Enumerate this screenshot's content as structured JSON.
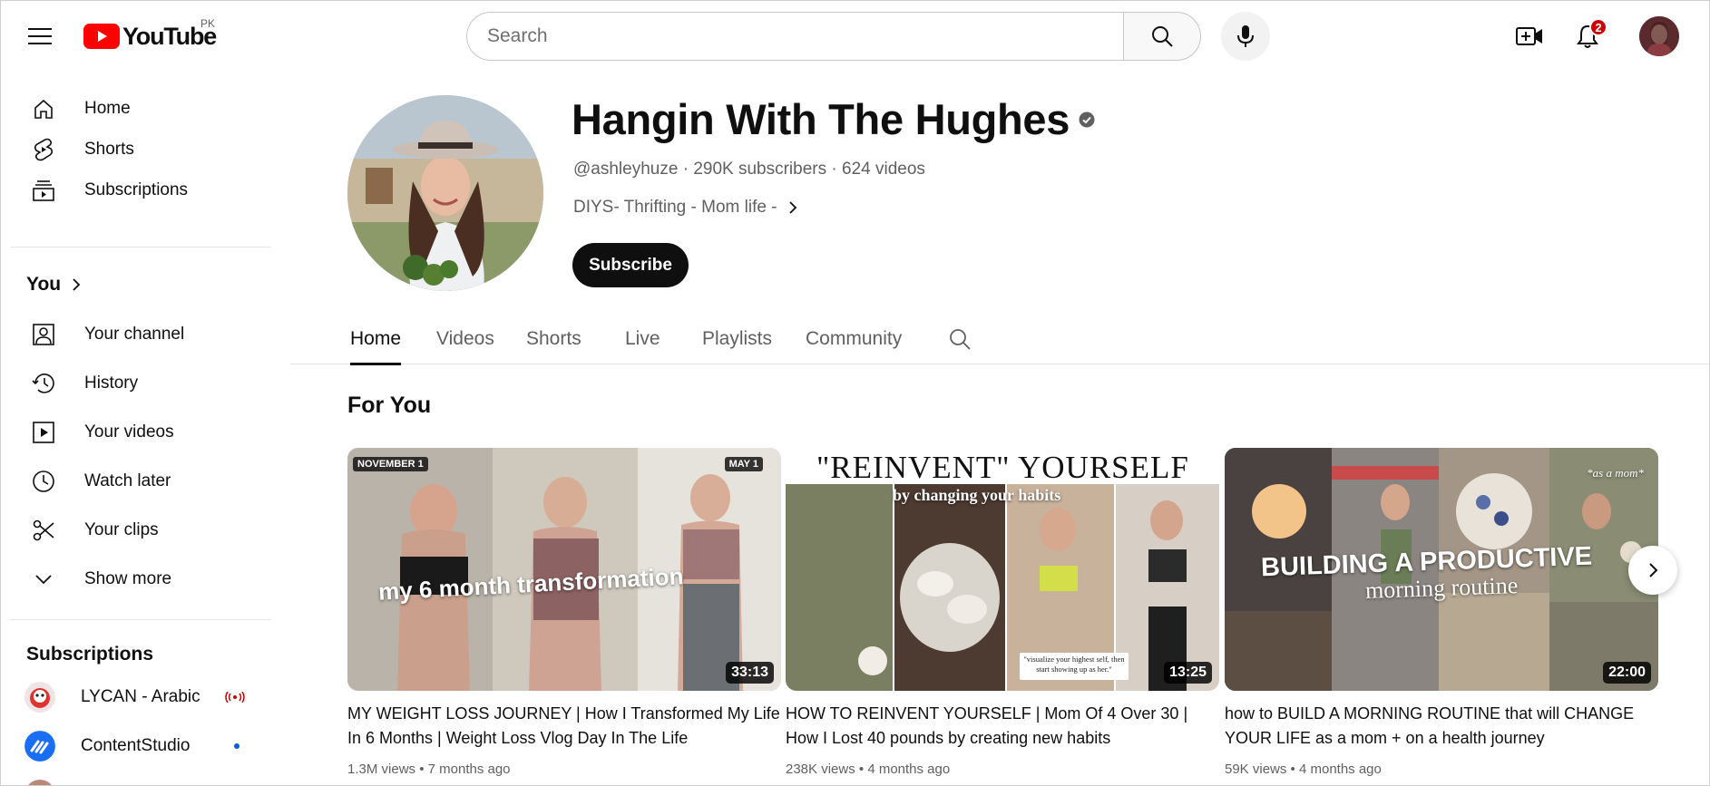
{
  "topbar": {
    "logo_text": "YouTube",
    "region": "PK",
    "search_placeholder": "Search",
    "notification_count": "2"
  },
  "sidebar": {
    "main": [
      {
        "label": "Home",
        "icon": "home-icon"
      },
      {
        "label": "Shorts",
        "icon": "shorts-icon"
      },
      {
        "label": "Subscriptions",
        "icon": "subscriptions-icon"
      }
    ],
    "you_heading": "You",
    "you_items": [
      {
        "label": "Your channel",
        "icon": "your-channel-icon"
      },
      {
        "label": "History",
        "icon": "history-icon"
      },
      {
        "label": "Your videos",
        "icon": "your-videos-icon"
      },
      {
        "label": "Watch later",
        "icon": "watch-later-icon"
      },
      {
        "label": "Your clips",
        "icon": "scissors-icon"
      },
      {
        "label": "Show more",
        "icon": "chevron-down-icon"
      }
    ],
    "subscriptions_heading": "Subscriptions",
    "subscriptions": [
      {
        "label": "LYCAN - Arabic",
        "status": "live"
      },
      {
        "label": "ContentStudio",
        "status": "new"
      }
    ]
  },
  "channel": {
    "name": "Hangin With The Hughes",
    "handle": "@ashleyhuze",
    "subscribers": "290K subscribers",
    "videos": "624 videos",
    "description": "DIYS- Thrifting - Mom life -",
    "subscribe_label": "Subscribe"
  },
  "tabs": [
    "Home",
    "Videos",
    "Shorts",
    "Live",
    "Playlists",
    "Community"
  ],
  "active_tab": "Home",
  "section": {
    "title": "For You",
    "videos": [
      {
        "title": "MY WEIGHT LOSS JOURNEY | How I Transformed My Life In 6 Months | Weight Loss Vlog Day In The Life",
        "views": "1.3M views",
        "age": "7 months ago",
        "duration": "33:13",
        "thumb_text": "my 6 month transformation",
        "thumb_tag_left": "NOVEMBER 1",
        "thumb_tag_right": "MAY 1"
      },
      {
        "title": "HOW TO REINVENT YOURSELF | Mom Of 4 Over 30 | How I Lost 40 pounds by creating new habits",
        "views": "238K views",
        "age": "4 months ago",
        "duration": "13:25",
        "thumb_heading": "\"REINVENT\" YOURSELF",
        "thumb_sub": "by changing your habits",
        "thumb_quote": "\"visualize your highest self, then start showing up as her.\""
      },
      {
        "title": "how to BUILD A MORNING ROUTINE that will CHANGE YOUR LIFE as a mom + on a health journey",
        "views": "59K views",
        "age": "4 months ago",
        "duration": "22:00",
        "thumb_heading": "BUILDING A PRODUCTIVE",
        "thumb_sub": "morning routine",
        "thumb_corner": "*as a mom*"
      }
    ]
  },
  "colors": {
    "brand_red": "#ff0000",
    "text_primary": "#0f0f0f",
    "text_secondary": "#606060",
    "live_red": "#cc0000",
    "new_blue": "#065fd4"
  }
}
